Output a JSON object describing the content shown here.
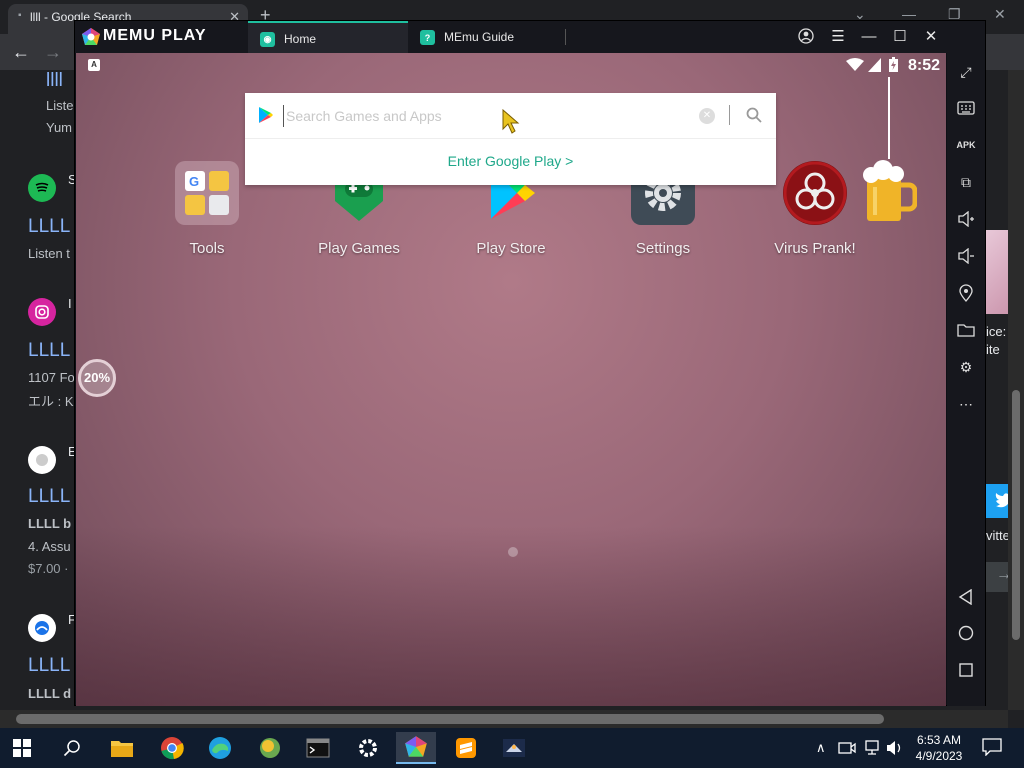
{
  "chrome": {
    "tab_title": "llll - Google Search",
    "new_tab": "+",
    "results": [
      {
        "title": "llll",
        "snippet": "Liste",
        "snippet2": "Yum"
      },
      {
        "site": "S",
        "title": "LLLL",
        "snippet": "Listen t"
      },
      {
        "site": "I",
        "title": "LLLL",
        "snippet": "1107 Fo",
        "snippet2": "エル : K"
      },
      {
        "site": "E",
        "title": "LLLL",
        "snippet": "LLLL b",
        "snippet2": "4. Assu",
        "price": "$7.00 ·"
      },
      {
        "site": "F",
        "title": "LLLL",
        "snippet": "LLLL d"
      }
    ],
    "right_peek": {
      "text1": "ice:",
      "text2": "ite",
      "text3": "vitte"
    }
  },
  "memu": {
    "brand": "MEMU PLAY",
    "tabs": [
      {
        "label": "Home",
        "active": true
      },
      {
        "label": "MEmu Guide",
        "active": false
      }
    ],
    "status": {
      "badge": "A",
      "time": "8:52"
    },
    "search": {
      "placeholder": "Search Games and Apps",
      "value": "",
      "enter_label": "Enter Google Play",
      "enter_chevron": ">"
    },
    "apps": [
      {
        "label": "Tools",
        "icon": "folder-icon"
      },
      {
        "label": "Play Games",
        "icon": "play-games-icon"
      },
      {
        "label": "Play Store",
        "icon": "play-store-icon"
      },
      {
        "label": "Settings",
        "icon": "settings-icon"
      },
      {
        "label": "Virus Prank!",
        "icon": "biohazard-icon"
      }
    ],
    "progress": {
      "text": "20%",
      "value": 20
    },
    "sidebar": [
      "expand-icon",
      "keyboard-icon",
      "apk-icon",
      "multi-window-icon",
      "volume-up-icon",
      "volume-down-icon",
      "location-icon",
      "folder-icon",
      "settings-icon",
      "more-icon",
      "back-icon",
      "home-icon",
      "recents-icon"
    ],
    "apk_label": "APK"
  },
  "taskbar": {
    "apps": [
      "file-explorer-icon",
      "chrome-icon",
      "edge-icon",
      "photos-icon",
      "terminal-icon",
      "settings-icon",
      "memu-icon",
      "sublime-icon",
      "game-icon"
    ],
    "time": "6:53 AM",
    "date": "4/9/2023"
  },
  "colors": {
    "accent": "#1fbf9f",
    "link": "#8ab4f8",
    "taskbar": "#101c2e"
  }
}
